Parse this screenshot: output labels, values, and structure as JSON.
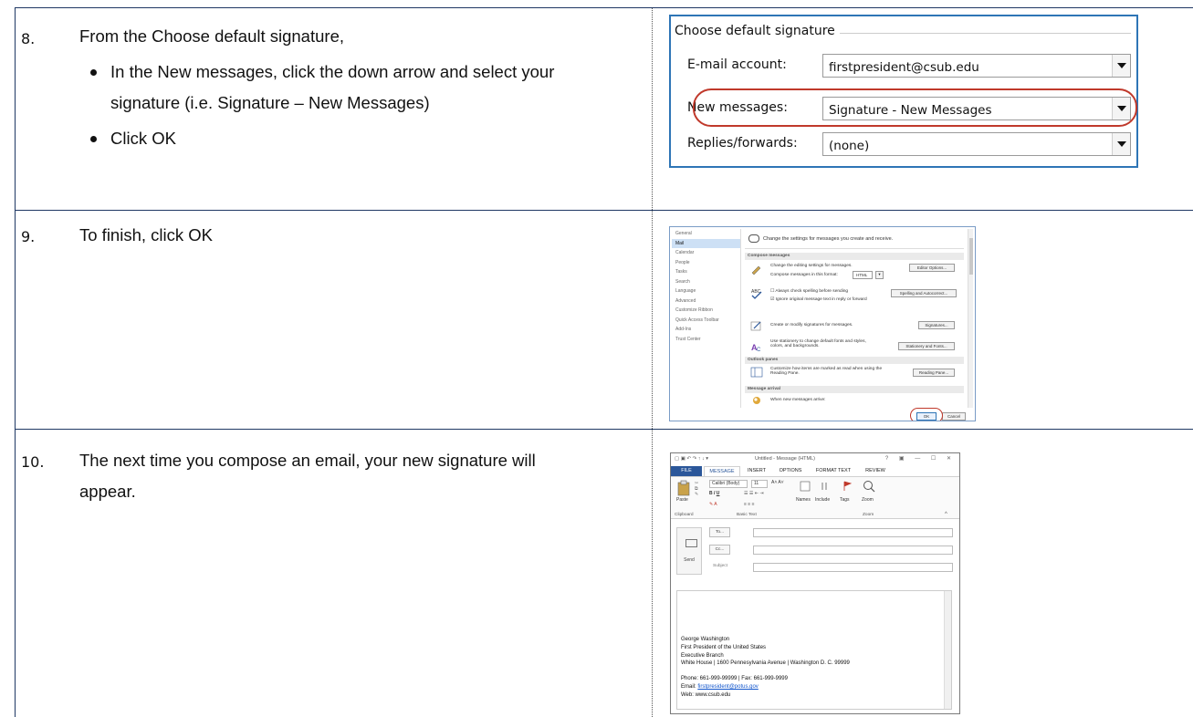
{
  "steps": [
    {
      "number": "8.",
      "intro": "From the Choose default signature,",
      "bullets": [
        "In the New messages, click the down arrow and select your signature (i.e. Signature – New Messages)",
        "Click OK"
      ]
    },
    {
      "number": "9.",
      "text": "To finish, click OK"
    },
    {
      "number": "10.",
      "text": "The next time you compose an email, your new signature will appear."
    }
  ],
  "signature_dialog": {
    "legend": "Choose default signature",
    "rows": [
      {
        "label": "E-mail account:",
        "value": "firstpresident@csub.edu"
      },
      {
        "label": "New messages:",
        "value": "Signature - New Messages"
      },
      {
        "label": "Replies/forwards:",
        "value": "(none)"
      }
    ]
  },
  "options_dialog": {
    "nav": [
      "General",
      "Mail",
      "Calendar",
      "People",
      "Tasks",
      "Search",
      "Language",
      "Advanced",
      "Customize Ribbon",
      "Quick Access Toolbar",
      "Add-Ins",
      "Trust Center"
    ],
    "nav_selected": "Mail",
    "header": "Change the settings for messages you create and receive.",
    "compose_section": "Compose messages",
    "editing_text": "Change the editing settings for messages.",
    "editor_button": "Editor Options...",
    "compose_format_label": "Compose messages in this format:",
    "compose_format_value": "HTML",
    "spell_always": "Always check spelling before sending",
    "spell_ignore": "Ignore original message text in reply or forward",
    "spell_button": "Spelling and Autocorrect...",
    "signature_text": "Create or modify signatures for messages.",
    "signature_button": "Signatures...",
    "stationery_text": "Use stationery to change default fonts and styles, colors, and backgrounds.",
    "stationery_button": "Stationery and Fonts...",
    "outlook_panes_section": "Outlook panes",
    "reading_text": "Customize how items are marked as read when using the Reading Pane.",
    "reading_button": "Reading Pane...",
    "arrival_section": "Message arrival",
    "arrival_text": "When new messages arrive:",
    "ok_label": "OK",
    "cancel_label": "Cancel"
  },
  "compose_window": {
    "title": "Untitled - Message (HTML)",
    "controls": "? ▣ — ☐ ✕",
    "tabs": [
      "FILE",
      "MESSAGE",
      "INSERT",
      "OPTIONS",
      "FORMAT TEXT",
      "REVIEW"
    ],
    "active_tab": "MESSAGE",
    "ribbon": {
      "paste": "Paste",
      "font": "Calibri (Body)",
      "size": "11",
      "names": "Names",
      "include": "Include",
      "tags": "Tags",
      "zoom": "Zoom",
      "group_clipboard": "Clipboard",
      "group_basic_text": "Basic Text",
      "group_zoom": "Zoom"
    },
    "send_label": "Send",
    "to_label": "To...",
    "cc_label": "Cc...",
    "subject_label": "Subject",
    "signature_lines": [
      "George Washington",
      "First President of the United States",
      "Executive Branch",
      "White House | 1600 Pennesylvania Avenue | Washington D. C. 99999"
    ],
    "phone_line": "Phone: 661-999-99999 | Fax: 661-999-9999",
    "email_label": "Email: ",
    "email_link": "firstpresident@potus.gov",
    "web_line": "Web: www.csub.edu"
  }
}
